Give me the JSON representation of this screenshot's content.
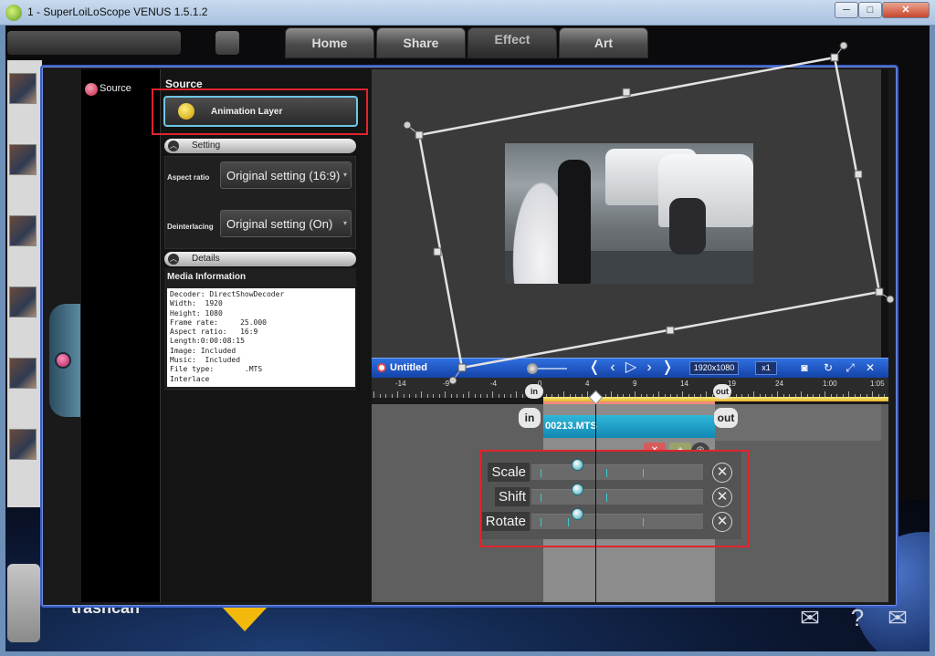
{
  "window": {
    "title": "1 - SuperLoiLoScope VENUS 1.5.1.2",
    "min_glyph": "─",
    "max_glyph": "□",
    "close_glyph": "✕"
  },
  "nav": {
    "tabs": [
      {
        "label": "Home"
      },
      {
        "label": "Share"
      },
      {
        "label": "Effect"
      },
      {
        "label": "Art"
      }
    ]
  },
  "bin": {
    "trash_label": "trashcan"
  },
  "source_panel": {
    "nav_label": "Source",
    "title": "Source",
    "animation_layer_label": "Animation Layer",
    "setting_header": "Setting",
    "aspect_ratio_label": "Aspect ratio",
    "aspect_ratio_value": "Original setting (16:9)",
    "deinterlacing_label": "Deinterlacing",
    "deinterlacing_value": "Original setting (On)",
    "details_header": "Details",
    "media_info_title": "Media Information",
    "media_info_text": "Decoder: DirectShowDecoder\nWidth:  1920\nHeight: 1080\nFrame rate:     25.000\nAspect ratio:   16:9\nLength:0:00:08:15\nImage: Included\nMusic:  Included\nFile type:       .MTS\nInterlace"
  },
  "timeline": {
    "title": "Untitled",
    "resolution": "1920x1080",
    "zoom": "x1",
    "ruler_labels": [
      "-14",
      "-9",
      "-4",
      "0",
      "4",
      "9",
      "14",
      "19",
      "24",
      "1:00",
      "1:05"
    ],
    "in_label": "in",
    "out_label": "out",
    "clip_name": "00213.MTS",
    "effects": [
      {
        "label": "Scale"
      },
      {
        "label": "Shift"
      },
      {
        "label": "Rotate"
      }
    ]
  },
  "colors": {
    "accent_blue": "#2f6fe0",
    "clip_cyan": "#2fb7d8",
    "highlight_red": "#e0242c",
    "playhead_yellow": "#f7ef7e"
  }
}
